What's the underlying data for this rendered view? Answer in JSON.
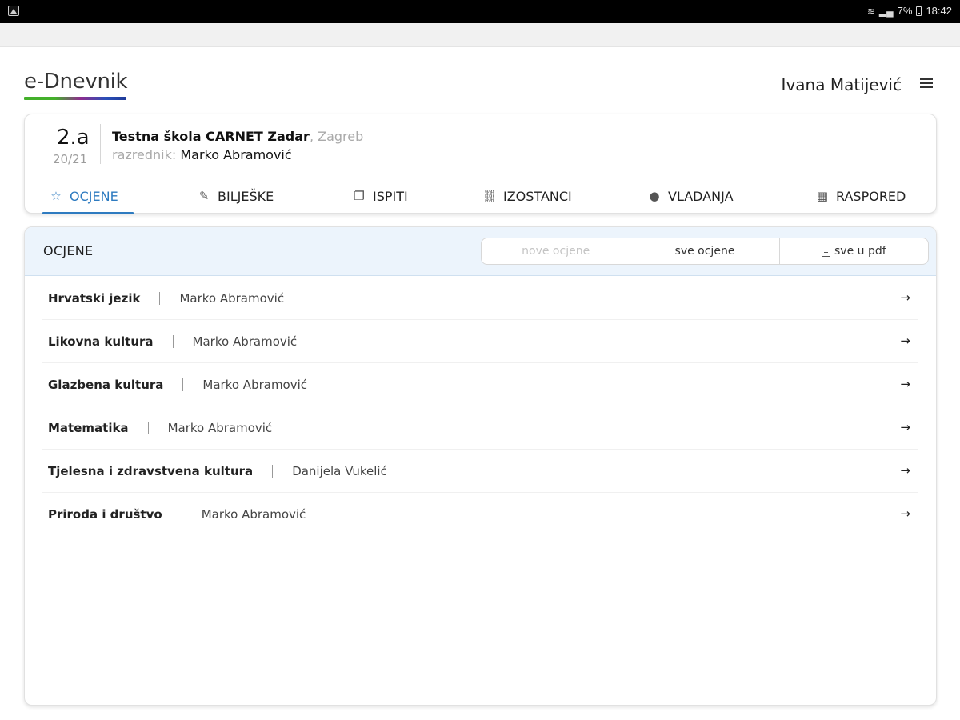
{
  "status_bar": {
    "battery": "7%",
    "time": "18:42",
    "icons": [
      "image-notification-icon",
      "wifi-icon",
      "signal-icon",
      "battery-icon"
    ]
  },
  "header": {
    "logo_text": "e-Dnevnik",
    "user_name": "Ivana Matijević",
    "menu_icon": "hamburger-menu-icon"
  },
  "class_info": {
    "class_name": "2.a",
    "school_year": "20/21",
    "school_name": "Testna škola CARNET Zadar",
    "school_city": ", Zagreb",
    "teacher_prefix": "razrednik: ",
    "teacher_name": "Marko Abramović"
  },
  "tabs": [
    {
      "label": "OCJENE",
      "icon": "star-icon",
      "active": true
    },
    {
      "label": "BILJEŠKE",
      "icon": "edit-icon",
      "active": false
    },
    {
      "label": "ISPITI",
      "icon": "copy-icon",
      "active": false
    },
    {
      "label": "IZOSTANCI",
      "icon": "link-icon",
      "active": false
    },
    {
      "label": "VLADANJA",
      "icon": "info-icon",
      "active": false
    },
    {
      "label": "RASPORED",
      "icon": "calendar-icon",
      "active": false
    }
  ],
  "grades_panel": {
    "title": "OCJENE",
    "buttons": {
      "new_grades": "nove ocjene",
      "all_grades": "sve ocjene",
      "all_pdf": "sve u pdf"
    },
    "subjects": [
      {
        "name": "Hrvatski jezik",
        "teacher": "Marko Abramović",
        "arrow": "→"
      },
      {
        "name": "Likovna kultura",
        "teacher": "Marko Abramović",
        "arrow": "→"
      },
      {
        "name": "Glazbena kultura",
        "teacher": "Marko Abramović",
        "arrow": "→"
      },
      {
        "name": "Matematika",
        "teacher": "Marko Abramović",
        "arrow": "→"
      },
      {
        "name": "Tjelesna i zdravstvena kultura",
        "teacher": "Danijela Vukelić",
        "arrow": "→"
      },
      {
        "name": "Priroda i društvo",
        "teacher": "Marko Abramović",
        "arrow": "→"
      }
    ]
  },
  "colors": {
    "accent": "#2e7bc0",
    "panel_header_bg": "#ecf4fc",
    "logo_gradient": [
      "#43b02a",
      "#8e2c8e",
      "#2a4fb8"
    ]
  }
}
